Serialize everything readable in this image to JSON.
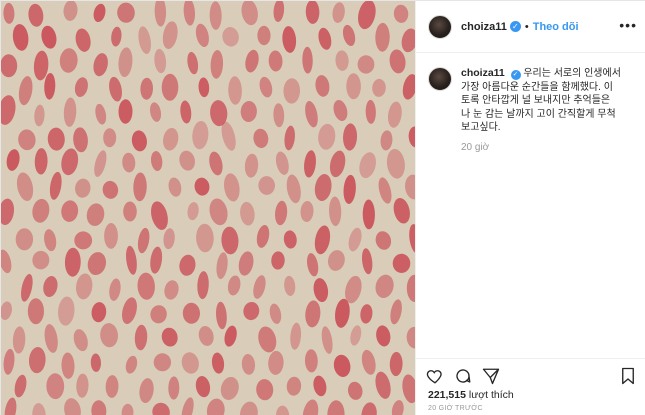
{
  "photo": {
    "alt_theme": "lipstick-print-pattern",
    "base_color": "#d9cdb9",
    "mark_color": "#c8434f"
  },
  "post": {
    "username": "choiza11",
    "verified_icon": "verified-badge-icon",
    "separator": "•",
    "follow_label": "Theo dõi",
    "more_label": "•••",
    "caption_lines": [
      "우리는 서로의 인생에서",
      "가장 아름다운 순간들을 함께했다. 이",
      "토록 안타깝게 널 보내지만 추억들은",
      "나 눈 감는 날까지 고이 간직할게 무척",
      "보고싶다."
    ],
    "caption_age": "20 giờ",
    "likes_count": "221,515",
    "likes_label": "lượt thích",
    "posted_ago": "20 GIỜ TRƯỚC"
  },
  "icons": [
    "heart-icon",
    "comment-icon",
    "share-icon",
    "bookmark-icon"
  ],
  "colors": {
    "accent": "#3897f0",
    "text": "#262626",
    "muted": "#999999"
  }
}
